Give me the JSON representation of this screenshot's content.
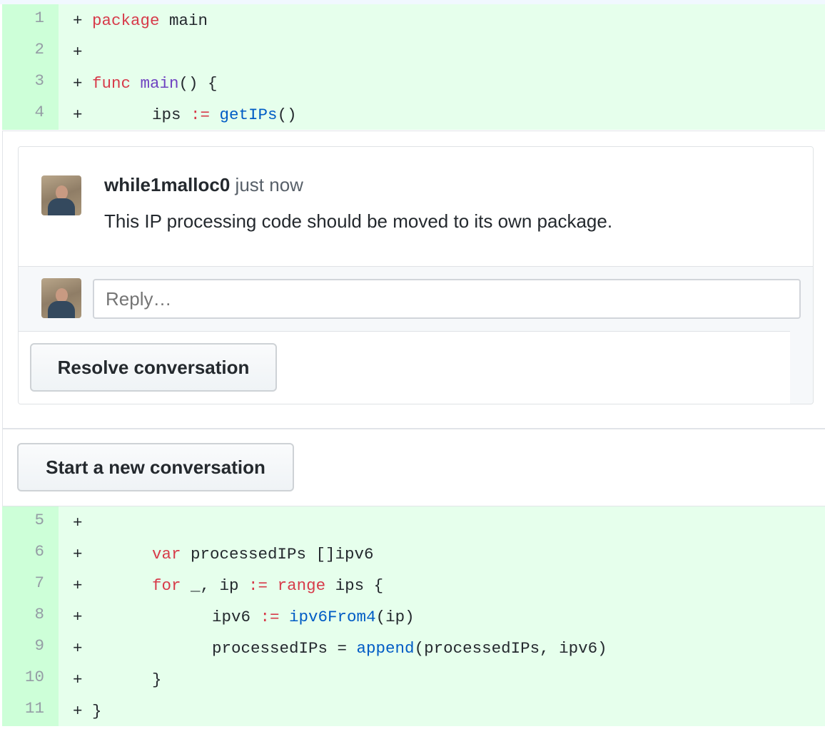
{
  "diff_top": [
    {
      "num": "1",
      "indent": 0,
      "tokens": [
        {
          "t": "package",
          "c": "kw"
        },
        {
          "t": " main",
          "c": "p"
        }
      ]
    },
    {
      "num": "2",
      "indent": 0,
      "tokens": []
    },
    {
      "num": "3",
      "indent": 0,
      "tokens": [
        {
          "t": "func",
          "c": "kw"
        },
        {
          "t": " ",
          "c": "p"
        },
        {
          "t": "main",
          "c": "fn"
        },
        {
          "t": "() {",
          "c": "p"
        }
      ]
    },
    {
      "num": "4",
      "indent": 1,
      "tokens": [
        {
          "t": "ips ",
          "c": "p"
        },
        {
          "t": ":=",
          "c": "kw"
        },
        {
          "t": " ",
          "c": "p"
        },
        {
          "t": "getIPs",
          "c": "call"
        },
        {
          "t": "()",
          "c": "p"
        }
      ]
    }
  ],
  "diff_bottom": [
    {
      "num": "5",
      "indent": 0,
      "tokens": []
    },
    {
      "num": "6",
      "indent": 1,
      "tokens": [
        {
          "t": "var",
          "c": "kw"
        },
        {
          "t": " processedIPs []ipv6",
          "c": "p"
        }
      ]
    },
    {
      "num": "7",
      "indent": 1,
      "tokens": [
        {
          "t": "for",
          "c": "kw"
        },
        {
          "t": " _, ip ",
          "c": "p"
        },
        {
          "t": ":=",
          "c": "kw"
        },
        {
          "t": " ",
          "c": "p"
        },
        {
          "t": "range",
          "c": "kw"
        },
        {
          "t": " ips {",
          "c": "p"
        }
      ]
    },
    {
      "num": "8",
      "indent": 2,
      "tokens": [
        {
          "t": "ipv6 ",
          "c": "p"
        },
        {
          "t": ":=",
          "c": "kw"
        },
        {
          "t": " ",
          "c": "p"
        },
        {
          "t": "ipv6From4",
          "c": "call"
        },
        {
          "t": "(ip)",
          "c": "p"
        }
      ]
    },
    {
      "num": "9",
      "indent": 2,
      "tokens": [
        {
          "t": "processedIPs = ",
          "c": "p"
        },
        {
          "t": "append",
          "c": "call"
        },
        {
          "t": "(processedIPs, ipv6)",
          "c": "p"
        }
      ]
    },
    {
      "num": "10",
      "indent": 1,
      "tokens": [
        {
          "t": "}",
          "c": "p"
        }
      ]
    },
    {
      "num": "11",
      "indent": 0,
      "tokens": [
        {
          "t": "}",
          "c": "p"
        }
      ]
    }
  ],
  "plus_marker": "+",
  "thread": {
    "comment": {
      "author": "while1malloc0",
      "time": "just now",
      "body": "This IP processing code should be moved to its own package."
    },
    "reply_placeholder": "Reply…",
    "resolve_label": "Resolve conversation"
  },
  "new_conversation_label": "Start a new conversation"
}
